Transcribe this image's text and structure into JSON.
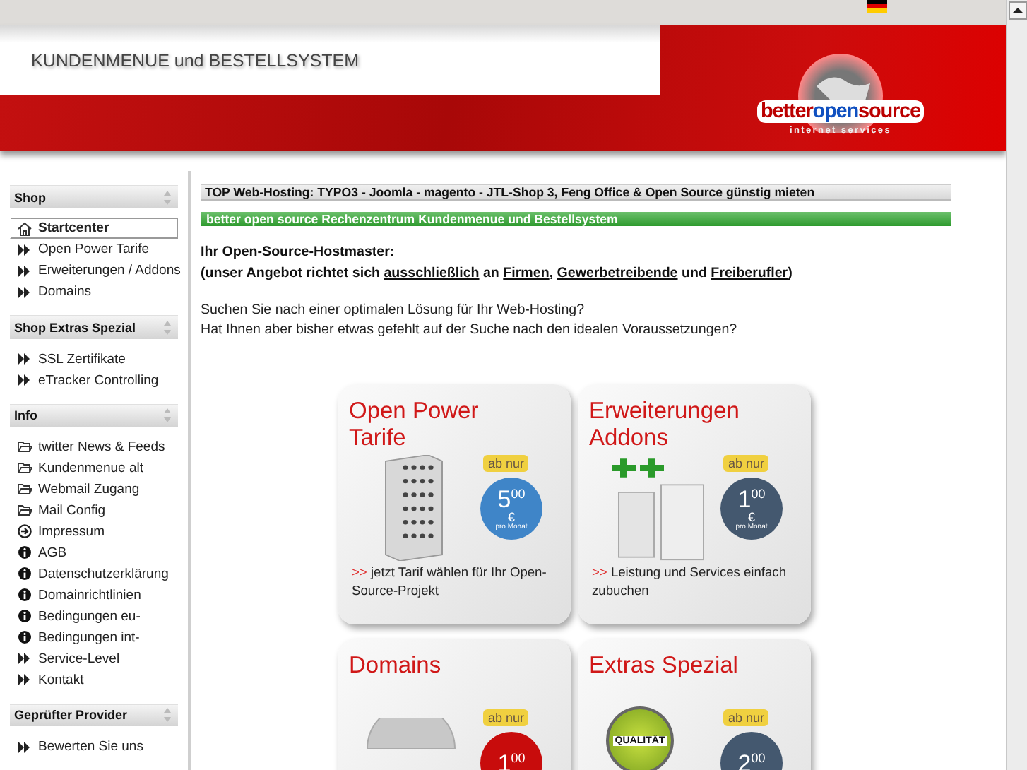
{
  "header": {
    "title": "KUNDENMENUE und BESTELLSYSTEM",
    "logo": {
      "parts": [
        "better",
        "open",
        "source"
      ],
      "tagline": "internet services"
    }
  },
  "sidebar": [
    {
      "title": "Shop",
      "items": [
        {
          "label": "Startcenter",
          "kind": "home",
          "selected": true
        },
        {
          "label": "Open Power Tarife",
          "kind": "arrow",
          "selected": false
        },
        {
          "label": "Erweiterungen / Addons",
          "kind": "arrow",
          "selected": false
        },
        {
          "label": "Domains",
          "kind": "arrow",
          "selected": false
        }
      ]
    },
    {
      "title": "Shop Extras Spezial",
      "items": [
        {
          "label": "SSL Zertifikate",
          "kind": "arrow",
          "selected": false
        },
        {
          "label": "eTracker Controlling",
          "kind": "arrow",
          "selected": false
        }
      ]
    },
    {
      "title": "Info",
      "items": [
        {
          "label": "twitter News & Feeds",
          "kind": "folder",
          "selected": false
        },
        {
          "label": "Kundenmenue alt",
          "kind": "folder",
          "selected": false
        },
        {
          "label": "Webmail Zugang",
          "kind": "folder",
          "selected": false
        },
        {
          "label": "Mail Config",
          "kind": "folder",
          "selected": false
        },
        {
          "label": "Impressum",
          "kind": "go",
          "selected": false
        },
        {
          "label": "AGB",
          "kind": "info",
          "selected": false
        },
        {
          "label": "Datenschutzerklärung",
          "kind": "info",
          "selected": false
        },
        {
          "label": "Domainrichtlinien",
          "kind": "info",
          "selected": false
        },
        {
          "label": "Bedingungen eu-",
          "kind": "info",
          "selected": false
        },
        {
          "label": "Bedingungen int-",
          "kind": "info",
          "selected": false
        },
        {
          "label": "Service-Level",
          "kind": "arrow",
          "selected": false
        },
        {
          "label": "Kontakt",
          "kind": "arrow",
          "selected": false
        }
      ]
    },
    {
      "title": "Geprüfter Provider",
      "items": [
        {
          "label": "Bewerten Sie uns",
          "kind": "arrow",
          "selected": false
        }
      ]
    }
  ],
  "main": {
    "headline": "TOP Web-Hosting: TYPO3 - Joomla - magento - JTL-Shop 3, Feng Office & Open Source günstig mieten",
    "banner": "better open source Rechenzentrum Kundenmenue und Bestellsystem",
    "intro_title": "Ihr Open-Source-Hostmaster:",
    "intro_line": [
      {
        "text": "(unser Angebot richtet sich ",
        "kind": "text"
      },
      {
        "text": "ausschließlich",
        "kind": "link"
      },
      {
        "text": " an ",
        "kind": "text"
      },
      {
        "text": "Firmen",
        "kind": "link"
      },
      {
        "text": ", ",
        "kind": "text"
      },
      {
        "text": "Gewerbetreibende",
        "kind": "link"
      },
      {
        "text": " und ",
        "kind": "text"
      },
      {
        "text": "Freiberufler",
        "kind": "link"
      },
      {
        "text": ")",
        "kind": "text"
      }
    ],
    "paragraph": [
      "Suchen Sie nach einer optimalen Lösung für Ihr Web-Hosting?",
      "Hat Ihnen aber bisher etwas gefehlt auf der Suche nach den idealen Voraussetzungen?"
    ],
    "tiles": [
      {
        "title": "Open Power Tarife",
        "kind": "server",
        "badge": "ab nur",
        "price": "5",
        "cents": "00",
        "currency": "€",
        "per": "pro Monat",
        "color": "#3f85c8",
        "marker": ">>",
        "caption": "jetzt Tarif wählen für Ihr Open-Source-Projekt"
      },
      {
        "title": "Erweiterungen Addons",
        "kind": "servers",
        "badge": "ab nur",
        "price": "1",
        "cents": "00",
        "currency": "€",
        "per": "pro Monat",
        "color": "#44586f",
        "marker": ">>",
        "caption": "Leistung und Services einfach zubuchen"
      },
      {
        "title": "Domains",
        "kind": "globe",
        "badge": "ab nur",
        "price": "1",
        "cents": "00",
        "color": "#c80c0c"
      },
      {
        "title": "Extras Spezial",
        "kind": "seal",
        "seal_text": "QUALITÄT",
        "badge": "ab nur",
        "price": "2",
        "cents": "00",
        "color": "#44586f"
      }
    ]
  }
}
